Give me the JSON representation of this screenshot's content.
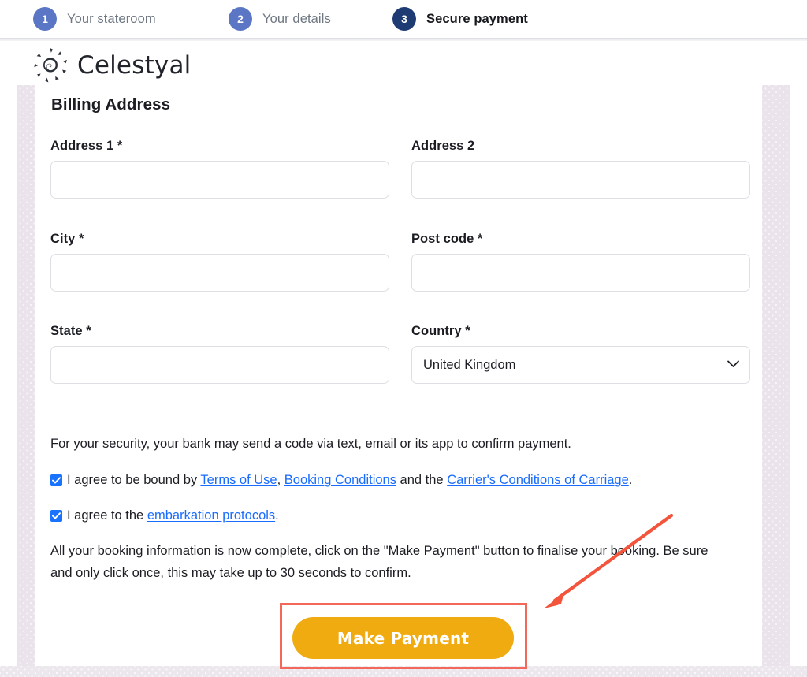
{
  "steps": [
    {
      "number": "1",
      "label": "Your stateroom",
      "active": false
    },
    {
      "number": "2",
      "label": "Your details",
      "active": false
    },
    {
      "number": "3",
      "label": "Secure payment",
      "active": true
    }
  ],
  "brand": {
    "name": "Celestyal",
    "logo_icon": "celestyal-sun-spiral-icon"
  },
  "form": {
    "section_title": "Billing Address",
    "fields": {
      "address1": {
        "label": "Address 1 *",
        "value": "",
        "placeholder": ""
      },
      "address2": {
        "label": "Address 2",
        "value": "",
        "placeholder": ""
      },
      "city": {
        "label": "City *",
        "value": "",
        "placeholder": ""
      },
      "postcode": {
        "label": "Post code *",
        "value": "",
        "placeholder": ""
      },
      "state": {
        "label": "State *",
        "value": "",
        "placeholder": ""
      },
      "country": {
        "label": "Country *",
        "value": "United Kingdom",
        "options": [
          "United Kingdom"
        ],
        "chevron_icon": "chevron-down-icon"
      }
    }
  },
  "legal": {
    "security_note": "For your security, your bank may send a code via text, email or its app to confirm payment.",
    "consent1": {
      "checked": true,
      "prefix": "I agree to be bound by ",
      "link1": "Terms of Use",
      "sep1": ", ",
      "link2": "Booking Conditions",
      "sep2": " and the ",
      "link3": "Carrier's Conditions of Carriage",
      "suffix": "."
    },
    "consent2": {
      "checked": true,
      "prefix": "I agree to the ",
      "link1": "embarkation protocols",
      "suffix": "."
    },
    "final_note": "All your booking information is now complete, click on the \"Make Payment\" button to finalise your booking. Be sure and only click once, this may take up to 30 seconds to confirm."
  },
  "actions": {
    "pay_label": "Make Payment"
  },
  "colors": {
    "step_inactive": "#5b76c4",
    "step_active": "#1f3b73",
    "link": "#1a6cff",
    "checkbox": "#1a73ff",
    "pay_button": "#f0ab11",
    "annotation": "#f2695b",
    "side_band": "#e9e2ea"
  }
}
